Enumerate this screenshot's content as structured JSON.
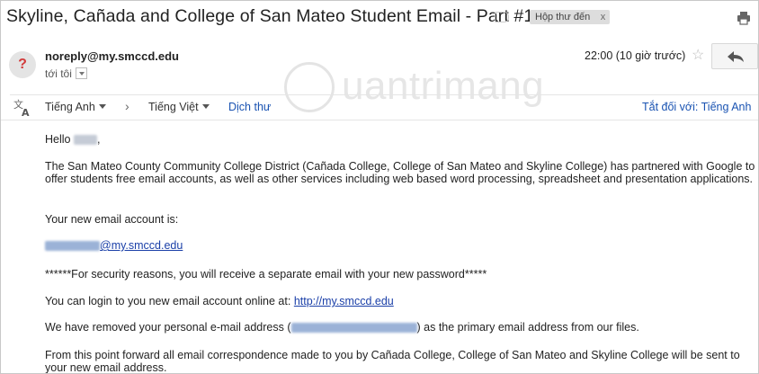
{
  "subject": "Skyline, Cañada and College of San Mateo Student Email - Part #1",
  "labels": {
    "inbox": "Hộp thư đến",
    "remove": "x"
  },
  "sender": {
    "email": "noreply@my.smccd.edu",
    "to": "tới tôi",
    "time": "22:00 (10 giờ trước)"
  },
  "translate_bar": {
    "from_lang": "Tiếng Anh",
    "to_lang": "Tiếng Việt",
    "translate_link": "Dịch thư",
    "turn_off": "Tắt đối với: Tiếng Anh"
  },
  "watermark": {
    "text": "uantrimang"
  },
  "email_body": {
    "greeting": "Hello",
    "intro": "The San Mateo County Community College District (Cañada College, College of San Mateo and Skyline College) has partnered with Google to offer students free email accounts, as well as other services including web based word processing, spreadsheet and presentation applications.",
    "account_label": "Your new email account is:",
    "new_email_domain": "@my.smccd.edu",
    "security_note": "******For security reasons, you will receive a separate email with your new password*****",
    "login_text": "You can login to you new email account online at:",
    "login_url": "http://my.smccd.edu",
    "removed_prefix": "We have removed your personal e-mail address (",
    "removed_suffix": ") as the primary email address from our files.",
    "forward_text": "From this point forward all email correspondence made to you by Cañada College, College of San Mateo and Skyline College will be sent to your new email address."
  },
  "colors": {
    "link": "#1a53b2",
    "avatar_mark": "#d23a3a"
  },
  "icons": [
    "print-icon",
    "unknown-sender-icon",
    "star-icon",
    "reply-icon",
    "translate-icon",
    "chevron-right-icon"
  ]
}
